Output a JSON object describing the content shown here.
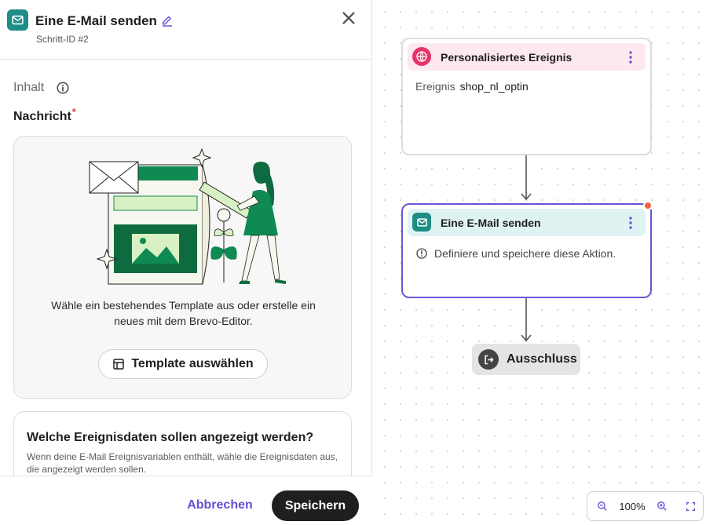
{
  "panel": {
    "title": "Eine E-Mail senden",
    "step_id": "Schritt-ID #2",
    "section_label": "Inhalt",
    "message_label": "Nachricht",
    "required_mark": "*",
    "template_description": "Wähle ein bestehendes Template aus oder erstelle ein neues mit dem Brevo-Editor.",
    "template_button": "Template auswählen",
    "event_title": "Welche Ereignisdaten sollen angezeigt werden?",
    "event_description": "Wenn deine E-Mail Ereignisvariablen enthält, wähle die Ereignisdaten aus, die angezeigt werden sollen.",
    "cancel_label": "Abbrechen",
    "save_label": "Speichern"
  },
  "canvas": {
    "node1": {
      "title": "Personalisiertes Ereignis",
      "field_label": "Ereignis",
      "field_value": "shop_nl_optin"
    },
    "node2": {
      "title": "Eine E-Mail senden",
      "message": "Definiere und speichere diese Aktion."
    },
    "exit_label": "Ausschluss",
    "zoom_level": "100%"
  },
  "colors": {
    "accent_purple": "#6a55d6",
    "email_teal": "#1d8d86",
    "event_pink": "#e5336b",
    "warning_dot": "#f2613f"
  },
  "icons": {
    "header": "email-icon",
    "edit": "pencil-icon",
    "close": "close-icon",
    "info": "info-icon",
    "template": "template-icon",
    "event": "globe-icon",
    "warning": "alert-circle-icon",
    "exit": "exit-icon",
    "zoom_out": "zoom-out-icon",
    "zoom_in": "zoom-in-icon",
    "fullscreen": "fullscreen-icon"
  }
}
